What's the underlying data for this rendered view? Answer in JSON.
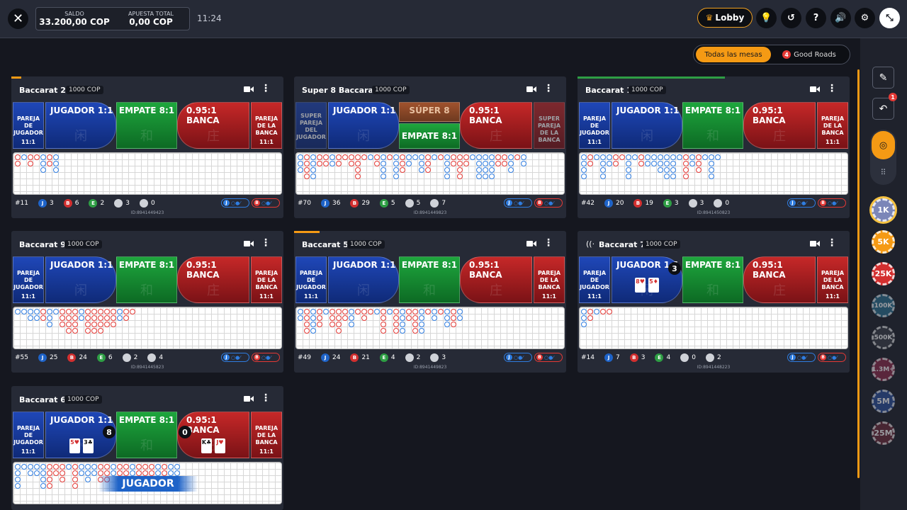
{
  "header": {
    "balance_label": "SALDO",
    "balance_value": "33.200,00 COP",
    "bet_label": "APUESTA TOTAL",
    "bet_value": "0,00 COP",
    "time": "11:24",
    "lobby_label": "Lobby",
    "icons": [
      "close-icon",
      "lightbulb-icon",
      "history-icon",
      "help-icon",
      "sound-icon",
      "settings-icon",
      "minimize-icon"
    ]
  },
  "filters": {
    "all_label": "Todas las mesas",
    "good_roads_count": "4",
    "good_roads_label": "Good Roads"
  },
  "colors": {
    "accent": "#f59a14",
    "player": "#1e63c8",
    "banker": "#d32f2f",
    "tie": "#2e9e44"
  },
  "tables": [
    {
      "title": "Baccarat 2",
      "stake": "1000 COP",
      "bets": {
        "pp": "PAREJA DE JUGADOR",
        "pp_odds": "11:1",
        "player": "JUGADOR 1:1",
        "tie": "EMPATE 8:1",
        "banker": "0.95:1 BANCA",
        "bp": "PAREJA DE LA BANCA",
        "bp_odds": "11:1"
      },
      "stats": {
        "round": "#11",
        "player": "3",
        "banker": "6",
        "tie": "2",
        "pp": "3",
        "bp": "0"
      },
      "id": "ID:8941449423"
    },
    {
      "title": "Super 8 Baccarat",
      "stake": "1000 COP",
      "bets": {
        "spp": "SUPER PAREJA DEL JUGADOR",
        "player": "JUGADOR 1:1",
        "super8": "SÚPER 8",
        "tie": "EMPATE 8:1",
        "banker": "0.95:1 BANCA",
        "sbp": "SUPER PAREJA DE LA BANCA"
      },
      "stats": {
        "round": "#70",
        "player": "36",
        "banker": "29",
        "tie": "5",
        "pp": "5",
        "bp": "7"
      },
      "id": "ID:8941449823"
    },
    {
      "title": "Baccarat 1",
      "stake": "1000 COP",
      "bets": {
        "pp": "PAREJA DE JUGADOR",
        "pp_odds": "11:1",
        "player": "JUGADOR 1:1",
        "tie": "EMPATE 8:1",
        "banker": "0.95:1 BANCA",
        "bp": "PAREJA DE LA BANCA",
        "bp_odds": "11:1"
      },
      "stats": {
        "round": "#42",
        "player": "20",
        "banker": "19",
        "tie": "3",
        "pp": "3",
        "bp": "0"
      },
      "id": "ID:8941450823"
    },
    {
      "title": "Baccarat 9",
      "stake": "1000 COP",
      "bets": {
        "pp": "PAREJA DE JUGADOR",
        "pp_odds": "11:1",
        "player": "JUGADOR 1:1",
        "tie": "EMPATE 8:1",
        "banker": "0.95:1 BANCA",
        "bp": "PAREJA DE LA BANCA",
        "bp_odds": "11:1"
      },
      "stats": {
        "round": "#55",
        "player": "25",
        "banker": "24",
        "tie": "6",
        "pp": "2",
        "bp": "4"
      },
      "id": "ID:8941445823"
    },
    {
      "title": "Baccarat 5",
      "stake": "1000 COP",
      "bets": {
        "pp": "PAREJA DE JUGADOR",
        "pp_odds": "11:1",
        "player": "JUGADOR 1:1",
        "tie": "EMPATE 8:1",
        "banker": "0.95:1 BANCA",
        "bp": "PAREJA DE LA BANCA",
        "bp_odds": "11:1"
      },
      "stats": {
        "round": "#49",
        "player": "24",
        "banker": "21",
        "tie": "4",
        "pp": "2",
        "bp": "3"
      },
      "id": "ID:8941449823"
    },
    {
      "title": "Baccarat 7",
      "stake": "1000 COP",
      "bets": {
        "pp": "PAREJA DE JUGADOR",
        "pp_odds": "11:1",
        "player": "JUGADOR 1:1",
        "tie": "EMPATE 8:1",
        "banker": "0.95:1 BANCA",
        "bp": "PAREJA DE LA BANCA",
        "bp_odds": "11:1"
      },
      "stats": {
        "round": "#14",
        "player": "7",
        "banker": "3",
        "tie": "4",
        "pp": "0",
        "bp": "2"
      },
      "player_score": "3",
      "player_cards": [
        "8♥",
        "5♦"
      ],
      "id": "ID:8941448223"
    },
    {
      "title": "Baccarat 6",
      "stake": "1000 COP",
      "bets": {
        "pp": "PAREJA DE JUGADOR",
        "pp_odds": "11:1",
        "player": "JUGADOR 1:1",
        "tie": "EMPATE 8:1",
        "banker": "0.95:1 BANCA",
        "bp": "PAREJA DE LA BANCA",
        "bp_odds": "11:1"
      },
      "player_score": "8",
      "banker_score": "0",
      "player_cards": [
        "5♥",
        "3♣"
      ],
      "banker_cards": [
        "K♣",
        "J♥"
      ],
      "result": "JUGADOR"
    }
  ],
  "bet_glyphs": {
    "player": "闲",
    "tie": "和",
    "banker": "庄"
  },
  "pred_labels": {
    "player": "J",
    "banker": "B"
  },
  "rail": {
    "notif_count": "1",
    "chips": [
      {
        "label": "1K",
        "color": "#7b86b8",
        "selected": true
      },
      {
        "label": "5K",
        "color": "#f59a14"
      },
      {
        "label": "25K",
        "color": "#d32f2f"
      },
      {
        "label": "100K",
        "color": "#2b6f8f"
      },
      {
        "label": "500K",
        "color": "#3b3f48"
      },
      {
        "label": "1.3M+",
        "color": "#8b2b4a"
      },
      {
        "label": "5M",
        "color": "#2a4f9a"
      },
      {
        "label": "25M",
        "color": "#6b2a3a"
      }
    ]
  }
}
